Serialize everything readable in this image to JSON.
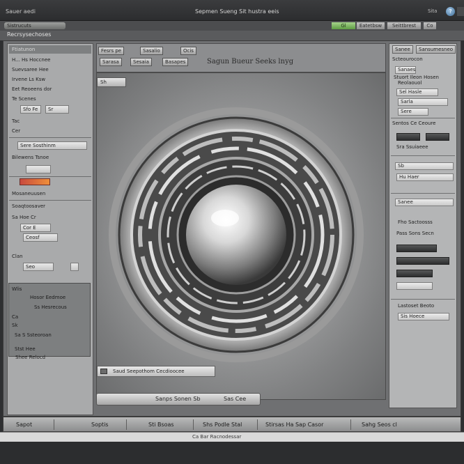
{
  "window": {
    "app_label": "Sauer aedi",
    "title": "Sepmen Sueng Sit hustra eeis",
    "mini_label": "Sita",
    "help_glyph": "?"
  },
  "menubar": {
    "workspace": "Sistrucuts",
    "status_green": "Gl",
    "btn1": "Eatetbsw",
    "btn2": "Seittbrest",
    "btn3": "Co"
  },
  "breadcrumb": "Recrsysechoses",
  "left_panel": {
    "header": "Ftiatunon",
    "rows": [
      "H... Hs Hoccnee",
      "Suevsaree Hee",
      "Irvene Ls Ksw",
      "Eet Reoeens dor",
      "Te Scenes",
      "Tac",
      "Cer",
      "Bilewens Tsnoe"
    ],
    "fields": [
      "Sfo Fe",
      "Sr",
      "Sere Sosthinm"
    ],
    "swatch_label": "Mosaneuusen",
    "mid_rows": [
      "Soaqtoosaver",
      "Sa Hoe Cr",
      "Cor E",
      "Ceosf",
      "Clan",
      "Seo"
    ],
    "dark_rows": [
      "Wlis",
      "Hosor Eedmoe",
      "Ss Hesrecous",
      "Ca",
      "Sk",
      "Sa S Ssteoroan",
      "Stst Hee",
      "Shee Relocd"
    ]
  },
  "canvas_tools": {
    "btn_a": "Fesrs pe",
    "btn_b": "Sasalio",
    "btn_c": "Sarasa",
    "btn_d": "Sesaia",
    "btn_e": "Basapes",
    "btn_f": "Ocis",
    "doc_title": "Sagun Bueur Seeks lnyg"
  },
  "canvas": {
    "zoom_chip": "Sh",
    "caption": "Saud Seepothom Cecdioocee"
  },
  "bottom_slider": {
    "label_a": "Sanps Sonen Sb",
    "label_b": "Sas Cee"
  },
  "right_panel": {
    "tab1": "Sanee",
    "tab2": "Sansumesneo",
    "rows": [
      "Scteourocon",
      "Stieeie",
      "Stuort Ileon Hosen",
      "Reolaouol",
      "Sentos Ce Ceoure",
      "Sra Ssuiaeee",
      "Fho Sactoosss",
      "Pass Sons Secn",
      "Lastoset Beoto"
    ],
    "fields": [
      "Sanaes",
      "Sel Hasle",
      "Sarla",
      "Sere",
      "Sb",
      "Hu Haer",
      "Sanee",
      "Sis Hoece"
    ]
  },
  "statusbar": {
    "items": [
      "Sapot",
      "Soptis",
      "Sti Bsoas",
      "Shs Podle Stal",
      "Stirsas Ha Sap Casor",
      "Sahg Seos cl"
    ]
  },
  "footer_text": "Ca Bar Racnodessar",
  "colors": {
    "chrome_dark": "#2e2f31",
    "panel_grey": "#a9aaab",
    "accent_green": "#5e9c43",
    "accent_red": "#c84a3e",
    "help_blue": "#3f6e98"
  }
}
